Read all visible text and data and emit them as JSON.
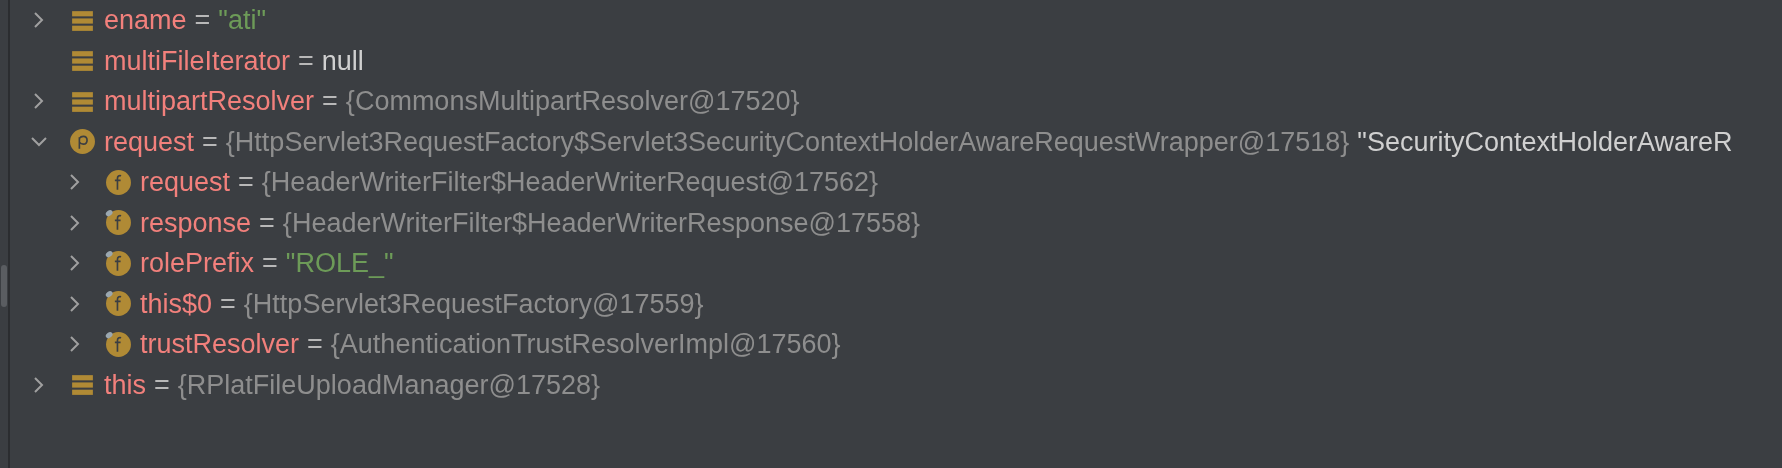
{
  "variables": [
    {
      "kind": "local",
      "final": false,
      "expanded": false,
      "name": "ename",
      "separator": "=",
      "value": {
        "kind": "string",
        "text": "\"ati\""
      }
    },
    {
      "kind": "local",
      "final": false,
      "name": "multiFileIterator",
      "separator": "=",
      "value": {
        "kind": "null",
        "text": "null"
      }
    },
    {
      "kind": "local",
      "final": false,
      "expanded": false,
      "name": "multipartResolver",
      "separator": "=",
      "value": {
        "kind": "object",
        "text": "{CommonsMultipartResolver@17520}"
      }
    },
    {
      "kind": "param",
      "final": false,
      "expanded": true,
      "name": "request",
      "separator": "=",
      "value": {
        "kind": "object",
        "text": "{HttpServlet3RequestFactory$Servlet3SecurityContextHolderAwareRequestWrapper@17518}"
      },
      "description": "\"SecurityContextHolderAwareR",
      "children": [
        {
          "kind": "field",
          "final": false,
          "expanded": false,
          "name": "request",
          "separator": "=",
          "value": {
            "kind": "object",
            "text": "{HeaderWriterFilter$HeaderWriterRequest@17562}"
          }
        },
        {
          "kind": "field",
          "final": true,
          "expanded": false,
          "name": "response",
          "separator": "=",
          "value": {
            "kind": "object",
            "text": "{HeaderWriterFilter$HeaderWriterResponse@17558}"
          }
        },
        {
          "kind": "field",
          "final": true,
          "expanded": false,
          "name": "rolePrefix",
          "separator": "=",
          "value": {
            "kind": "string",
            "text": "\"ROLE_\""
          }
        },
        {
          "kind": "field",
          "final": true,
          "expanded": false,
          "name": "this$0",
          "separator": "=",
          "value": {
            "kind": "object",
            "text": "{HttpServlet3RequestFactory@17559}"
          }
        },
        {
          "kind": "field",
          "final": true,
          "expanded": false,
          "name": "trustResolver",
          "separator": "=",
          "value": {
            "kind": "object",
            "text": "{AuthenticationTrustResolverImpl@17560}"
          }
        }
      ]
    },
    {
      "kind": "local",
      "final": false,
      "expanded": false,
      "name": "this",
      "separator": "=",
      "value": {
        "kind": "object",
        "text": "{RPlatFileUploadManager@17528}"
      }
    }
  ]
}
